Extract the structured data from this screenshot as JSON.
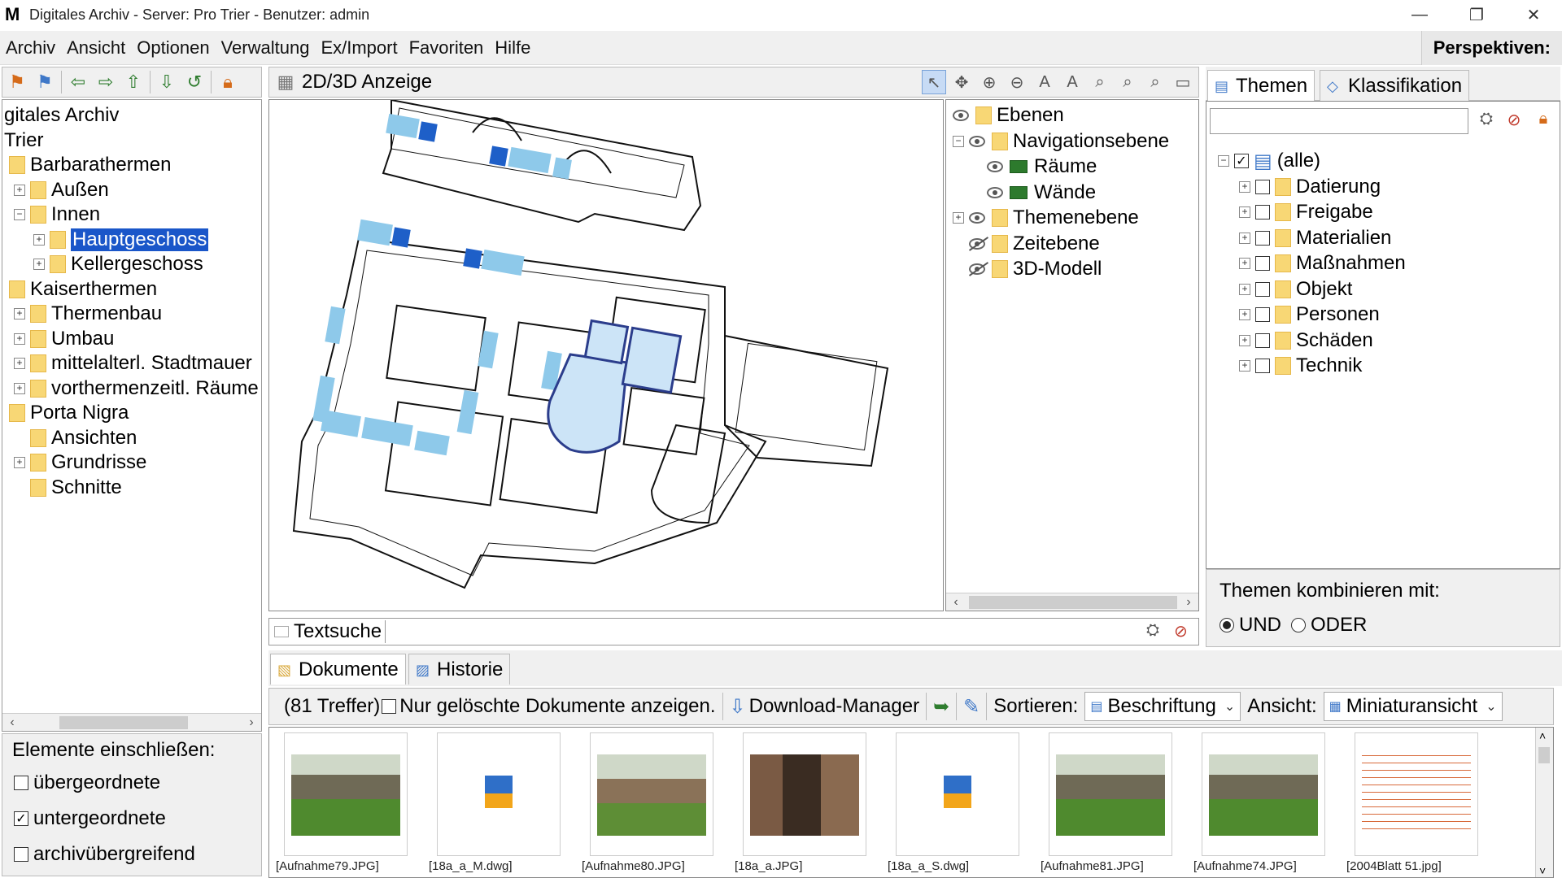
{
  "window": {
    "title": "Digitales Archiv - Server: Pro Trier - Benutzer: admin",
    "controls": [
      "—",
      "❐",
      "✕"
    ]
  },
  "menu": {
    "items": [
      "Archiv",
      "Ansicht",
      "Optionen",
      "Verwaltung",
      "Ex/Import",
      "Favoriten",
      "Hilfe"
    ],
    "perspectives_label": "Perspektiven:"
  },
  "left_tree": {
    "nodes": [
      {
        "label": "gitales Archiv",
        "level": 0,
        "folder": false,
        "expander": ""
      },
      {
        "label": "Trier",
        "level": 0,
        "folder": false,
        "expander": ""
      },
      {
        "label": "Barbarathermen",
        "level": 1,
        "folder": true,
        "expander": ""
      },
      {
        "label": "Außen",
        "level": 2,
        "folder": true,
        "expander": "+"
      },
      {
        "label": "Innen",
        "level": 2,
        "folder": true,
        "expander": "−"
      },
      {
        "label": "Hauptgeschoss",
        "level": 3,
        "folder": true,
        "expander": "+",
        "selected": true
      },
      {
        "label": "Kellergeschoss",
        "level": 3,
        "folder": true,
        "expander": "+"
      },
      {
        "label": "Kaiserthermen",
        "level": 1,
        "folder": true,
        "expander": ""
      },
      {
        "label": "Thermenbau",
        "level": 2,
        "folder": true,
        "expander": "+"
      },
      {
        "label": "Umbau",
        "level": 2,
        "folder": true,
        "expander": "+"
      },
      {
        "label": "mittelalterl. Stadtmauer",
        "level": 2,
        "folder": true,
        "expander": "+"
      },
      {
        "label": "vorthermenzeitl. Räume",
        "level": 2,
        "folder": true,
        "expander": "+"
      },
      {
        "label": "Porta Nigra",
        "level": 1,
        "folder": true,
        "expander": ""
      },
      {
        "label": "Ansichten",
        "level": 2,
        "folder": true,
        "expander": ""
      },
      {
        "label": "Grundrisse",
        "level": 2,
        "folder": true,
        "expander": "+"
      },
      {
        "label": "Schnitte",
        "level": 2,
        "folder": true,
        "expander": ""
      }
    ]
  },
  "include": {
    "header": "Elemente einschließen:",
    "options": [
      {
        "label": "übergeordnete",
        "checked": false
      },
      {
        "label": "untergeordnete",
        "checked": true
      },
      {
        "label": "archivübergreifend",
        "checked": false
      }
    ]
  },
  "view": {
    "title": "2D/3D Anzeige"
  },
  "layers": {
    "nodes": [
      {
        "label": "Ebenen",
        "level": 0,
        "eye": "on",
        "type": "folder",
        "expander": ""
      },
      {
        "label": "Navigationsebene",
        "level": 1,
        "eye": "on",
        "type": "folder",
        "expander": "−"
      },
      {
        "label": "Räume",
        "level": 2,
        "eye": "on",
        "type": "layer",
        "expander": ""
      },
      {
        "label": "Wände",
        "level": 2,
        "eye": "on",
        "type": "layer",
        "expander": ""
      },
      {
        "label": "Themenebene",
        "level": 1,
        "eye": "on",
        "type": "folder",
        "expander": "+"
      },
      {
        "label": "Zeitebene",
        "level": 1,
        "eye": "off",
        "type": "folder",
        "expander": ""
      },
      {
        "label": "3D-Modell",
        "level": 1,
        "eye": "off",
        "type": "folder",
        "expander": ""
      }
    ]
  },
  "right": {
    "tabs": [
      "Themen",
      "Klassifikation"
    ],
    "search_value": "",
    "themes": [
      {
        "label": "(alle)",
        "checked": true,
        "level": 0
      },
      {
        "label": "Datierung",
        "checked": false,
        "level": 1
      },
      {
        "label": "Freigabe",
        "checked": false,
        "level": 1
      },
      {
        "label": "Materialien",
        "checked": false,
        "level": 1
      },
      {
        "label": "Maßnahmen",
        "checked": false,
        "level": 1
      },
      {
        "label": "Objekt",
        "checked": false,
        "level": 1
      },
      {
        "label": "Personen",
        "checked": false,
        "level": 1
      },
      {
        "label": "Schäden",
        "checked": false,
        "level": 1
      },
      {
        "label": "Technik",
        "checked": false,
        "level": 1
      }
    ],
    "combine_label": "Themen kombinieren mit:",
    "combine_und": "UND",
    "combine_oder": "ODER",
    "combine_selected": "UND"
  },
  "textsearch": {
    "label": "Textsuche",
    "value": ""
  },
  "documents": {
    "tabs": [
      "Dokumente",
      "Historie"
    ],
    "hits": "(81 Treffer)",
    "deleted_label": "Nur gelöschte Dokumente anzeigen.",
    "deleted_checked": false,
    "download_manager": "Download-Manager",
    "sort_label": "Sortieren:",
    "sort_value": "Beschriftung",
    "view_label": "Ansicht:",
    "view_value": "Miniaturansicht",
    "items": [
      {
        "label": "[Aufnahme79.JPG]",
        "kind": "photo-grass"
      },
      {
        "label": "[18a_a_M.dwg]",
        "kind": "dwg"
      },
      {
        "label": "[Aufnahme80.JPG]",
        "kind": "photo-wall"
      },
      {
        "label": "[18a_a.JPG]",
        "kind": "photo-arch"
      },
      {
        "label": "[18a_a_S.dwg]",
        "kind": "dwg"
      },
      {
        "label": "[Aufnahme81.JPG]",
        "kind": "photo-grass"
      },
      {
        "label": "[Aufnahme74.JPG]",
        "kind": "photo-grass"
      },
      {
        "label": "[2004Blatt 51.jpg]",
        "kind": "drawing"
      }
    ]
  },
  "colors": {
    "selection": "#1a56c9",
    "room_light": "#8ec9ea",
    "room_dark": "#1e5fc8",
    "folder": "#f8d775"
  }
}
